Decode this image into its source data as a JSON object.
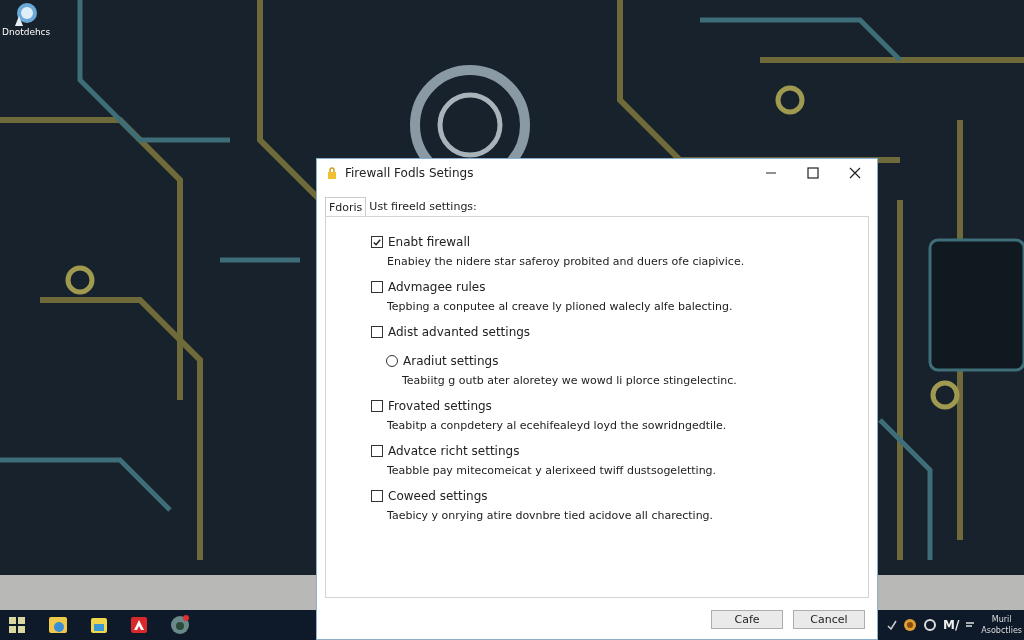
{
  "desktop": {
    "icons": [
      {
        "label": "Dnotdehcs"
      }
    ]
  },
  "window": {
    "title": "Firewall Fodls Setings",
    "tabs": [
      {
        "label": "Fdoris",
        "selected": true
      },
      {
        "label": "Ust fireeld settings:",
        "selected": false
      }
    ],
    "options": [
      {
        "kind": "checkbox",
        "checked": true,
        "label": "Enabt firewall",
        "description": "Enabiey the nidere star saferoy probited and duers ofe ciapivice."
      },
      {
        "kind": "checkbox",
        "checked": false,
        "label": "Advmagee rules",
        "description": "Tepbing a conputee al creave ly plioned walecly alfe balecting."
      },
      {
        "kind": "checkbox",
        "checked": false,
        "label": "Adist advanted settings",
        "children": [
          {
            "kind": "radio",
            "checked": false,
            "label": "Aradiut settings",
            "description": "Teabiitg g outb ater aloretey we wowd li plorce stingelectinc."
          }
        ]
      },
      {
        "kind": "checkbox",
        "checked": false,
        "label": "Frovated settings",
        "description": "Teabitp a conpdetery al ecehifealeyd loyd the sowridngedtile."
      },
      {
        "kind": "checkbox",
        "checked": false,
        "label": "Advatce richt settings",
        "description": "Teabble pay mitecomeicat y alerixeed twiff dustsogeletting."
      },
      {
        "kind": "checkbox",
        "checked": false,
        "label": "Coweed settings",
        "description": "Taebicy y onrying atire dovnbre tied acidove all charecting."
      }
    ],
    "buttons": [
      {
        "label": "Cafe"
      },
      {
        "label": "Cancel"
      }
    ]
  },
  "taskbar": {
    "tray_text": "M/",
    "clock": [
      "Muril",
      "Asobctlies"
    ]
  }
}
